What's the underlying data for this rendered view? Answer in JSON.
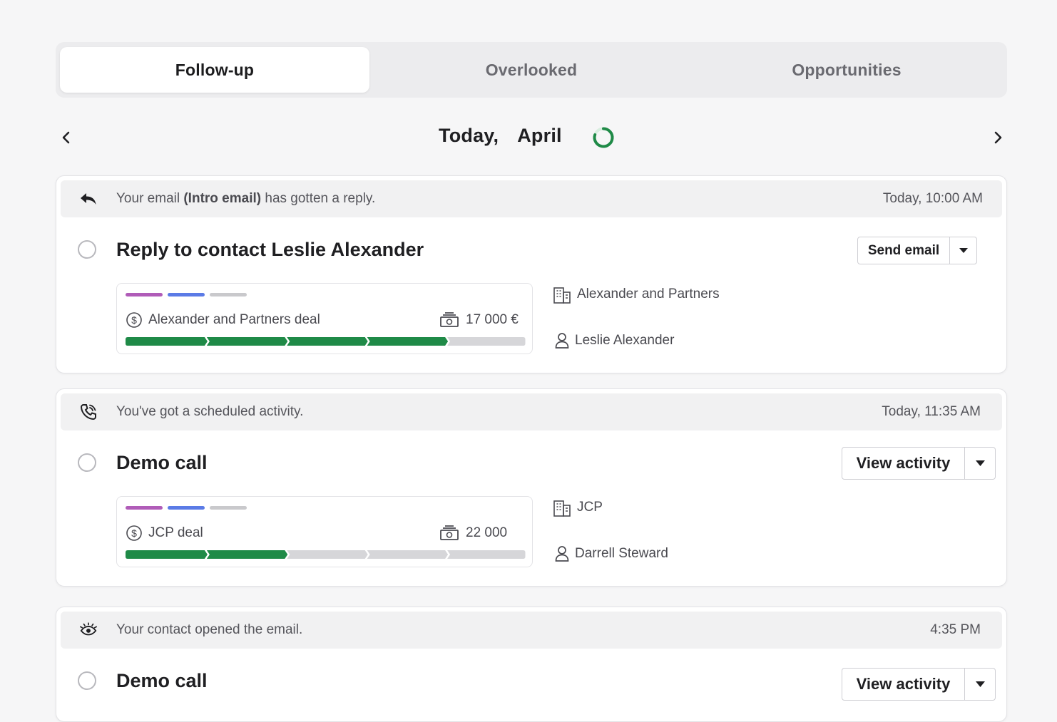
{
  "tabs": [
    {
      "label": "Follow-up",
      "active": true
    },
    {
      "label": "Overlooked",
      "active": false
    },
    {
      "label": "Opportunities",
      "active": false
    }
  ],
  "date_nav": {
    "day": "Today,",
    "month": "April"
  },
  "cards": [
    {
      "notice": {
        "icon": "reply-icon",
        "text_prefix": "Your email ",
        "text_bold": "(Intro email)",
        "text_suffix": " has gotten a reply.",
        "time": "Today, 10:00 AM"
      },
      "task_title": "Reply to contact Leslie Alexander",
      "action_label": "Send email",
      "deal": {
        "tag_colors": [
          "#b05cb8",
          "#5b7be6",
          "#c9c9cc"
        ],
        "name": "Alexander and Partners deal",
        "amount": "17 000 €",
        "stages_total": 5,
        "stages_completed": 4
      },
      "company": "Alexander and Partners",
      "contact": "Leslie Alexander"
    },
    {
      "notice": {
        "icon": "phone-icon",
        "text_prefix": "You've got a scheduled activity.",
        "text_bold": "",
        "text_suffix": "",
        "time": "Today, 11:35 AM"
      },
      "task_title": "Demo call",
      "action_label": "View activity",
      "deal": {
        "tag_colors": [
          "#b05cb8",
          "#5b7be6",
          "#c9c9cc"
        ],
        "name": "JCP deal",
        "amount": "22 000",
        "stages_total": 5,
        "stages_completed": 2
      },
      "company": "JCP",
      "contact": "Darrell Steward"
    },
    {
      "notice": {
        "icon": "eye-icon",
        "text_prefix": "Your contact opened the email.",
        "text_bold": "",
        "text_suffix": "",
        "time": "4:35 PM"
      },
      "task_title": "Demo call",
      "action_label": "View activity"
    }
  ],
  "colors": {
    "progress_done": "#1f8a47",
    "progress_todo": "#d6d6d9",
    "spinner": "#1f8a47"
  }
}
